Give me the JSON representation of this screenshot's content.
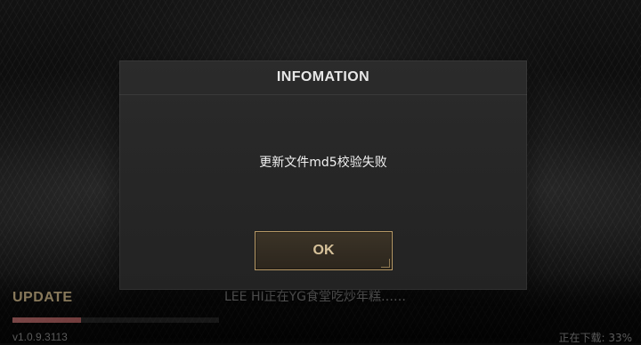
{
  "dialog": {
    "title": "INFOMATION",
    "message": "更新文件md5校验失败",
    "ok_label": "OK"
  },
  "update": {
    "label": "UPDATE",
    "tip": "LEE HI正在YG食堂吃炒年糕……",
    "version": "v1.0.9.3113",
    "download_status": "正在下载: 33%",
    "progress": 0.33
  },
  "colors": {
    "accent_gold": "#b99b67",
    "update_label": "#cbb486",
    "progress_red": "#c76b6b"
  }
}
